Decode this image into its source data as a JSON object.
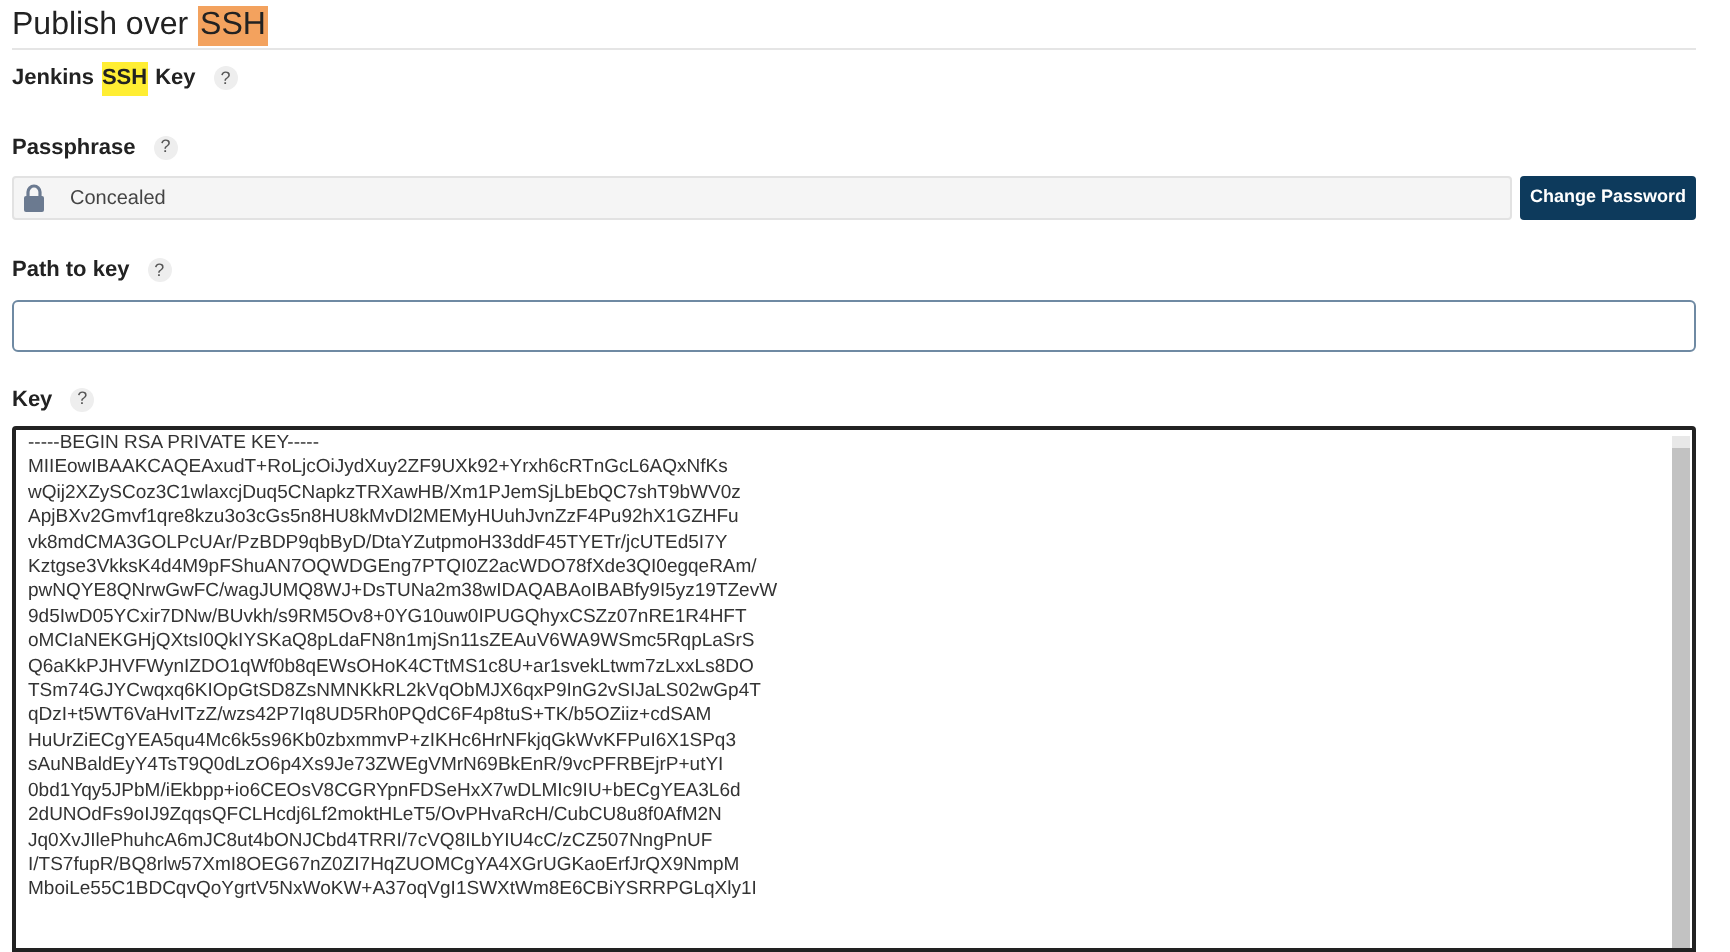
{
  "section_title": [
    {
      "text": "Publish over",
      "highlighted": false
    },
    {
      "text": "SSH",
      "highlighted": true
    }
  ],
  "fields": [
    {
      "kind": "heading",
      "label": [
        {
          "text": "Jenkins",
          "highlighted": false
        },
        {
          "text": "SSH",
          "highlighted": true
        },
        {
          "text": "Key",
          "highlighted": false
        }
      ],
      "help": "?"
    },
    {
      "kind": "secret",
      "label": [
        {
          "text": "Passphrase",
          "highlighted": false
        }
      ],
      "help": "?",
      "value": "Concealed",
      "button": "Change Password"
    },
    {
      "kind": "text",
      "label": [
        {
          "text": "Path to key",
          "highlighted": false
        }
      ],
      "help": "?"
    },
    {
      "kind": "textarea",
      "label": [
        {
          "text": "Key",
          "highlighted": false
        }
      ],
      "help": "?",
      "lines": [
        "-----BEGIN RSA PRIVATE KEY-----",
        "MIIEowIBAAKCAQEAxudT+RoLjcOiJydXuy2ZF9UXk92+Yrxh6cRTnGcL6AQxNfKs",
        "wQij2XZySCoz3C1wlaxcjDuq5CNapkzTRXawHB/Xm1PJemSjLbEbQC7shT9bWV0z",
        "ApjBXv2Gmvf1qre8kzu3o3cGs5n8HU8kMvDl2MEMyHUuhJvnZzF4Pu92hX1GZHFu",
        "vk8mdCMA3GOLPcUAr/PzBDP9qbByD/DtaYZutpmoH33ddF45TYETr/jcUTEd5I7Y",
        "Kztgse3VkksK4d4M9pFShuAN7OQWDGEng7PTQI0Z2acWDO78fXde3QI0egqeRAm/",
        "pwNQYE8QNrwGwFC/wagJUMQ8WJ+DsTUNa2m38wIDAQABAoIBABfy9I5yz19TZevW",
        "9d5IwD05YCxir7DNw/BUvkh/s9RM5Ov8+0YG10uw0IPUGQhyxCSZz07nRE1R4HFT",
        "oMCIaNEKGHjQXtsI0QkIYSKaQ8pLdaFN8n1mjSn11sZEAuV6WA9WSmc5RqpLaSrS",
        "Q6aKkPJHVFWynIZDO1qWf0b8qEWsOHoK4CTtMS1c8U+ar1svekLtwm7zLxxLs8DO",
        "TSm74GJYCwqxq6KIOpGtSD8ZsNMNKkRL2kVqObMJX6qxP9InG2vSIJaLS02wGp4T",
        "qDzI+t5WT6VaHvITzZ/wzs42P7Iq8UD5Rh0PQdC6F4p8tuS+TK/b5OZiiz+cdSAM",
        "HuUrZiECgYEA5qu4Mc6k5s96Kb0zbxmmvP+zIKHc6HrNFkjqGkWvKFPuI6X1SPq3",
        "sAuNBaldEyY4TsT9Q0dLzO6p4Xs9Je73ZWEgVMrN69BkEnR/9vcPFRBEjrP+utYI",
        "0bd1Yqy5JPbM/iEkbpp+io6CEOsV8CGRYpnFDSeHxX7wDLMIc9IU+bECgYEA3L6d",
        "2dUNOdFs9oIJ9ZqqsQFCLHcdj6Lf2moktHLeT5/OvPHvaRcH/CubCU8u8f0AfM2N",
        "Jq0XvJIlePhuhcA6mJC8ut4bONJCbd4TRRI/7cVQ8ILbYIU4cC/zCZ507NngPnUF",
        "I/TS7fupR/BQ8rlw57XmI8OEG67nZ0ZI7HqZUOMCgYA4XGrUGKaoErfJrQX9NmpM",
        "MboiLe55C1BDCqvQoYgrtV5NxWoKW+A37oqVgI1SWXtWm8E6CBiYSRRPGLqXly1I"
      ]
    }
  ]
}
